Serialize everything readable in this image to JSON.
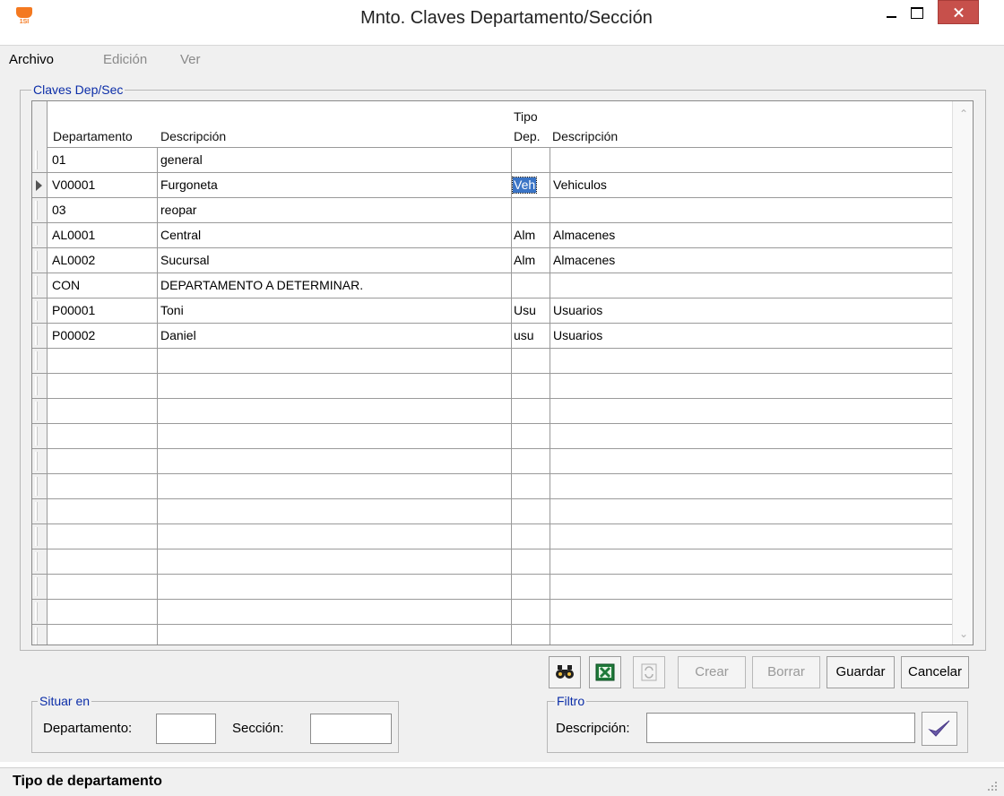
{
  "window": {
    "title": "Mnto. Claves Departamento/Sección",
    "icon_text": "1SI"
  },
  "menu": [
    {
      "label": "Archivo",
      "enabled": true
    },
    {
      "label": "Edición",
      "enabled": false
    },
    {
      "label": "Ver",
      "enabled": false
    }
  ],
  "group": {
    "legend": "Claves Dep/Sec"
  },
  "grid": {
    "headers": {
      "departamento": "Departamento",
      "descripcion": "Descripción",
      "tipo_line1": "Tipo",
      "tipo_line2": "Dep.",
      "descripcion2": "Descripción"
    },
    "rows": [
      {
        "dep": "01",
        "desc": "general",
        "tipo": "",
        "tdesc": ""
      },
      {
        "dep": "V00001",
        "desc": "Furgoneta",
        "tipo": "Veh",
        "tdesc": "Vehiculos"
      },
      {
        "dep": "03",
        "desc": "reopar",
        "tipo": "",
        "tdesc": ""
      },
      {
        "dep": "AL0001",
        "desc": "Central",
        "tipo": "Alm",
        "tdesc": "Almacenes"
      },
      {
        "dep": "AL0002",
        "desc": "Sucursal",
        "tipo": "Alm",
        "tdesc": "Almacenes"
      },
      {
        "dep": "CON",
        "desc": "DEPARTAMENTO A DETERMINAR.",
        "tipo": "",
        "tdesc": ""
      },
      {
        "dep": "P00001",
        "desc": "Toni",
        "tipo": "Usu",
        "tdesc": "Usuarios"
      },
      {
        "dep": "P00002",
        "desc": "Daniel",
        "tipo": "usu",
        "tdesc": "Usuarios"
      }
    ],
    "current_row": 1
  },
  "toolbar": {
    "find_icon": "binoculars-icon",
    "excel_icon": "excel-icon",
    "refresh_icon": "refresh-icon",
    "crear": "Crear",
    "borrar": "Borrar",
    "guardar": "Guardar",
    "cancelar": "Cancelar"
  },
  "situar": {
    "legend": "Situar en",
    "departamento_label": "Departamento:",
    "departamento_value": "",
    "seccion_label": "Sección:",
    "seccion_value": ""
  },
  "filtro": {
    "legend": "Filtro",
    "descripcion_label": "Descripción:",
    "descripcion_value": "",
    "apply_icon": "checkmark-icon"
  },
  "status": {
    "text": "Tipo de departamento"
  }
}
